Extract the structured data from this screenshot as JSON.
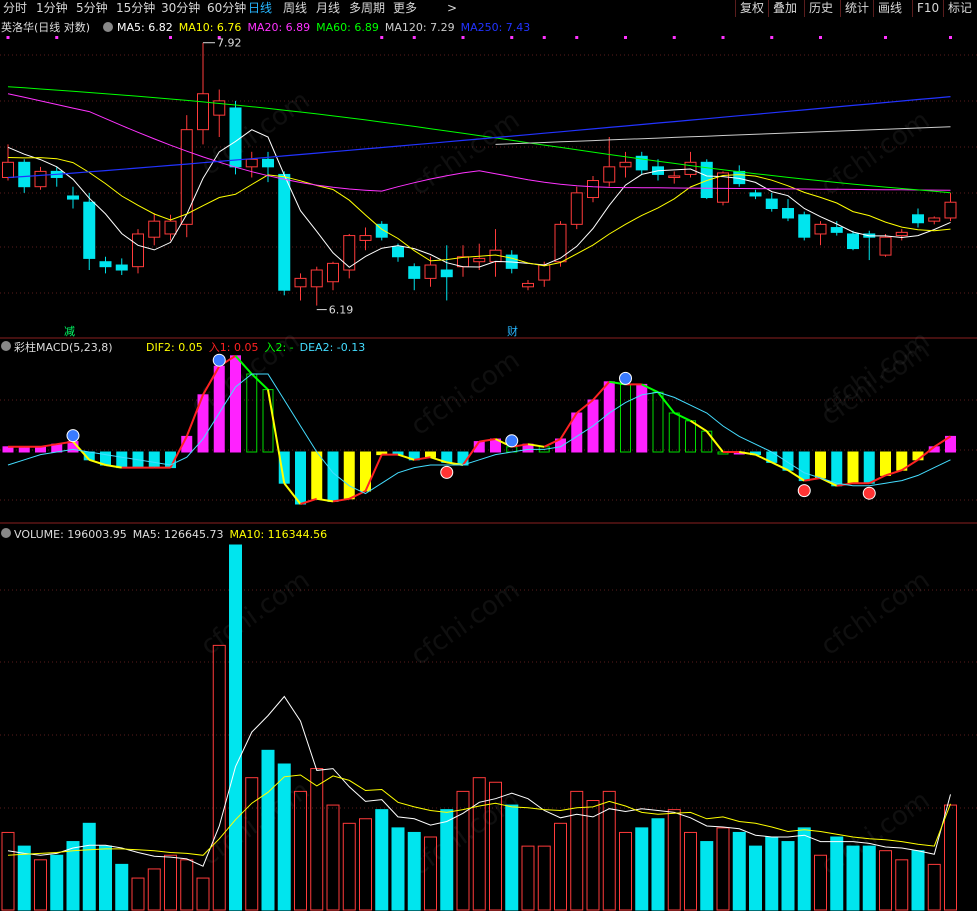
{
  "toolbar": {
    "periods": [
      {
        "label": "分时",
        "active": false
      },
      {
        "label": "1分钟",
        "active": false
      },
      {
        "label": "5分钟",
        "active": false
      },
      {
        "label": "15分钟",
        "active": false
      },
      {
        "label": "30分钟",
        "active": false
      },
      {
        "label": "60分钟",
        "active": false
      },
      {
        "label": "日线",
        "active": true
      },
      {
        "label": "周线",
        "active": false
      },
      {
        "label": "月线",
        "active": false
      },
      {
        "label": "多周期",
        "active": false
      },
      {
        "label": "更多",
        "active": false
      }
    ],
    "more_arrow": ">",
    "actions": [
      "复权",
      "叠加",
      "历史",
      "统计",
      "画线",
      "F10",
      "标记"
    ]
  },
  "price_panel": {
    "title": "英洛华(日线 对数)",
    "ma": [
      {
        "label": "MA5: 6.82",
        "color": "#ffffff"
      },
      {
        "label": "MA10: 6.76",
        "color": "#ffff00"
      },
      {
        "label": "MA20: 6.89",
        "color": "#ff33ff"
      },
      {
        "label": "MA60: 6.89",
        "color": "#00ff00"
      },
      {
        "label": "MA120: 7.29",
        "color": "#cccccc"
      },
      {
        "label": "MA250: 7.43",
        "color": "#2233ff"
      }
    ],
    "high_label": "7.92",
    "low_label": "6.19",
    "marker_jian": "减",
    "marker_cai": "财"
  },
  "macd_panel": {
    "title": "彩柱MACD(5,23,8)",
    "values": [
      {
        "label": "DIF2: 0.05",
        "color": "#ffff00"
      },
      {
        "label": "入1: 0.05",
        "color": "#ff2222"
      },
      {
        "label": "入2: -",
        "color": "#00ff00"
      },
      {
        "label": "DEA2: -0.13",
        "color": "#44ddff"
      }
    ]
  },
  "volume_panel": {
    "values": [
      {
        "label": "VOLUME: 196003.95",
        "color": "#dddddd"
      },
      {
        "label": "MA5: 126645.73",
        "color": "#dddddd"
      },
      {
        "label": "MA10: 116344.56",
        "color": "#ffff00"
      }
    ]
  },
  "watermark": "cfchi.com",
  "colors": {
    "up": "#ff3b3b",
    "down": "#00e5ee",
    "background": "#000000",
    "grid": "#5a1d1d"
  },
  "chart_data": [
    {
      "type": "candlestick",
      "title": "英洛华(日线 对数)",
      "yscale": "log",
      "ylim": [
        6.05,
        8.0
      ],
      "annotations": [
        {
          "text": "7.92",
          "x": 13
        },
        {
          "text": "6.19",
          "x": 20
        }
      ],
      "candles": [
        [
          6.98,
          7.2,
          6.96,
          7.08
        ],
        [
          7.08,
          7.1,
          6.88,
          6.92
        ],
        [
          6.92,
          7.05,
          6.9,
          7.02
        ],
        [
          7.02,
          7.05,
          6.92,
          6.98
        ],
        [
          6.86,
          6.92,
          6.78,
          6.84
        ],
        [
          6.82,
          6.88,
          6.4,
          6.47
        ],
        [
          6.45,
          6.48,
          6.38,
          6.42
        ],
        [
          6.43,
          6.47,
          6.37,
          6.4
        ],
        [
          6.42,
          6.65,
          6.38,
          6.62
        ],
        [
          6.6,
          6.75,
          6.55,
          6.7
        ],
        [
          6.62,
          6.74,
          6.58,
          6.7
        ],
        [
          6.68,
          7.4,
          6.6,
          7.3
        ],
        [
          7.3,
          7.92,
          7.2,
          7.55
        ],
        [
          7.4,
          7.58,
          7.25,
          7.5
        ],
        [
          7.45,
          7.5,
          7.0,
          7.05
        ],
        [
          7.05,
          7.15,
          6.98,
          7.1
        ],
        [
          7.1,
          7.15,
          6.95,
          7.05
        ],
        [
          7.0,
          7.02,
          6.25,
          6.28
        ],
        [
          6.3,
          6.38,
          6.22,
          6.35
        ],
        [
          6.3,
          6.42,
          6.19,
          6.4
        ],
        [
          6.33,
          6.45,
          6.28,
          6.44
        ],
        [
          6.4,
          6.62,
          6.35,
          6.61
        ],
        [
          6.58,
          6.66,
          6.52,
          6.61
        ],
        [
          6.68,
          6.7,
          6.58,
          6.6
        ],
        [
          6.54,
          6.56,
          6.45,
          6.48
        ],
        [
          6.42,
          6.44,
          6.28,
          6.35
        ],
        [
          6.35,
          6.48,
          6.3,
          6.43
        ],
        [
          6.4,
          6.55,
          6.22,
          6.36
        ],
        [
          6.42,
          6.55,
          6.36,
          6.48
        ],
        [
          6.45,
          6.56,
          6.4,
          6.47
        ],
        [
          6.45,
          6.65,
          6.36,
          6.52
        ],
        [
          6.49,
          6.52,
          6.38,
          6.41
        ],
        [
          6.3,
          6.34,
          6.28,
          6.32
        ],
        [
          6.34,
          6.45,
          6.3,
          6.43
        ],
        [
          6.45,
          6.7,
          6.42,
          6.68
        ],
        [
          6.68,
          6.92,
          6.65,
          6.88
        ],
        [
          6.85,
          6.99,
          6.82,
          6.96
        ],
        [
          6.95,
          7.25,
          6.92,
          7.05
        ],
        [
          7.05,
          7.15,
          6.98,
          7.08
        ],
        [
          7.12,
          7.15,
          7.0,
          7.03
        ],
        [
          7.05,
          7.1,
          6.96,
          7.0
        ],
        [
          6.98,
          7.02,
          6.94,
          6.99
        ],
        [
          7.0,
          7.15,
          6.98,
          7.08
        ],
        [
          7.08,
          7.1,
          6.84,
          6.85
        ],
        [
          6.82,
          7.02,
          6.8,
          7.01
        ],
        [
          7.02,
          7.06,
          6.92,
          6.94
        ],
        [
          6.88,
          6.9,
          6.84,
          6.86
        ],
        [
          6.84,
          6.88,
          6.76,
          6.78
        ],
        [
          6.78,
          6.84,
          6.7,
          6.72
        ],
        [
          6.74,
          6.76,
          6.58,
          6.6
        ],
        [
          6.62,
          6.7,
          6.55,
          6.68
        ],
        [
          6.66,
          6.7,
          6.61,
          6.63
        ],
        [
          6.62,
          6.64,
          6.52,
          6.53
        ],
        [
          6.62,
          6.64,
          6.46,
          6.6
        ],
        [
          6.49,
          6.62,
          6.48,
          6.6
        ],
        [
          6.61,
          6.65,
          6.58,
          6.63
        ],
        [
          6.74,
          6.78,
          6.66,
          6.69
        ],
        [
          6.7,
          6.73,
          6.68,
          6.72
        ],
        [
          6.72,
          6.88,
          6.7,
          6.82
        ]
      ]
    },
    {
      "type": "bar",
      "title": "彩柱MACD(5,23,8)",
      "ylim": [
        -0.5,
        0.45
      ],
      "values": [
        0.02,
        0.02,
        0.02,
        0.03,
        0.04,
        -0.03,
        -0.05,
        -0.06,
        -0.06,
        -0.06,
        -0.06,
        0.06,
        0.22,
        0.33,
        0.37,
        0.3,
        0.24,
        -0.12,
        -0.2,
        -0.18,
        -0.19,
        -0.18,
        -0.15,
        -0.01,
        -0.01,
        -0.03,
        -0.02,
        -0.04,
        -0.05,
        0.04,
        0.05,
        0.02,
        0.03,
        0.02,
        0.05,
        0.15,
        0.2,
        0.27,
        0.26,
        0.26,
        0.23,
        0.15,
        0.12,
        0.08,
        0.0,
        0.0,
        -0.01,
        -0.04,
        -0.07,
        -0.11,
        -0.1,
        -0.13,
        -0.12,
        -0.12,
        -0.09,
        -0.07,
        -0.03,
        0.02,
        0.06
      ],
      "series": [
        {
          "name": "DIF2",
          "values": [
            0.02,
            0.02,
            0.02,
            0.03,
            0.04,
            -0.03,
            -0.05,
            -0.06,
            -0.06,
            -0.06,
            -0.06,
            0.06,
            0.22,
            0.33,
            0.37,
            0.3,
            0.24,
            -0.12,
            -0.2,
            -0.18,
            -0.19,
            -0.18,
            -0.15,
            -0.01,
            -0.01,
            -0.03,
            -0.02,
            -0.04,
            -0.05,
            0.04,
            0.05,
            0.02,
            0.03,
            0.02,
            0.05,
            0.15,
            0.2,
            0.27,
            0.26,
            0.26,
            0.23,
            0.15,
            0.12,
            0.08,
            0.0,
            0.0,
            -0.01,
            -0.04,
            -0.07,
            -0.11,
            -0.1,
            -0.13,
            -0.12,
            -0.12,
            -0.09,
            -0.07,
            -0.03,
            0.02,
            0.06
          ]
        },
        {
          "name": "DEA2",
          "values": [
            -0.05,
            -0.03,
            -0.01,
            0.0,
            0.01,
            0.0,
            -0.01,
            -0.02,
            -0.03,
            -0.04,
            -0.05,
            -0.02,
            0.05,
            0.15,
            0.25,
            0.3,
            0.3,
            0.2,
            0.1,
            0.0,
            -0.08,
            -0.13,
            -0.16,
            -0.12,
            -0.08,
            -0.06,
            -0.05,
            -0.05,
            -0.05,
            -0.03,
            -0.01,
            0.0,
            0.01,
            0.01,
            0.02,
            0.06,
            0.1,
            0.15,
            0.19,
            0.22,
            0.23,
            0.21,
            0.18,
            0.15,
            0.1,
            0.06,
            0.03,
            0.0,
            -0.04,
            -0.08,
            -0.1,
            -0.12,
            -0.13,
            -0.13,
            -0.12,
            -0.11,
            -0.09,
            -0.06,
            -0.03
          ]
        }
      ]
    },
    {
      "type": "bar",
      "title": "VOLUME",
      "ylim": [
        0,
        400000
      ],
      "values": [
        85000,
        70000,
        55000,
        60000,
        75000,
        95000,
        70000,
        50000,
        35000,
        45000,
        60000,
        55000,
        35000,
        290000,
        400000,
        145000,
        175000,
        160000,
        130000,
        155000,
        115000,
        95000,
        100000,
        110000,
        90000,
        85000,
        80000,
        110000,
        130000,
        145000,
        140000,
        115000,
        70000,
        70000,
        95000,
        130000,
        120000,
        130000,
        85000,
        90000,
        100000,
        110000,
        85000,
        75000,
        90000,
        85000,
        70000,
        80000,
        75000,
        90000,
        60000,
        80000,
        70000,
        70000,
        65000,
        55000,
        65000,
        50000,
        115000
      ],
      "series": [
        {
          "name": "MA5",
          "values": [
            65000,
            62000,
            60000,
            62000,
            68000,
            71000,
            71000,
            68000,
            63000,
            59000,
            58000,
            56000,
            48000,
            92000,
            157000,
            195000,
            213000,
            234000,
            207000,
            153000,
            155000,
            135000,
            119000,
            121000,
            102000,
            100000,
            93000,
            97000,
            106000,
            118000,
            122000,
            128000,
            122000,
            109000,
            101000,
            105000,
            102000,
            111000,
            108000,
            111000,
            109000,
            107000,
            101000,
            92000,
            91000,
            89000,
            82000,
            80000,
            80000,
            82000,
            75000,
            75000,
            75000,
            73000,
            69000,
            68000,
            65000,
            61000,
            126645.73
          ]
        },
        {
          "name": "MA10",
          "values": [
            60000,
            61000,
            62000,
            63000,
            65000,
            66000,
            67000,
            67000,
            66000,
            65000,
            63000,
            62000,
            60000,
            78000,
            99000,
            117000,
            129000,
            146000,
            148000,
            136000,
            147000,
            142000,
            131000,
            132000,
            118000,
            113000,
            109000,
            107000,
            110000,
            114000,
            117000,
            113000,
            112000,
            110000,
            109000,
            112000,
            113000,
            119000,
            114000,
            107000,
            105000,
            106000,
            107000,
            100000,
            102000,
            97000,
            95000,
            91000,
            86000,
            88000,
            86000,
            83000,
            80000,
            78000,
            77000,
            75000,
            72000,
            70000,
            116344.56
          ]
        }
      ]
    }
  ]
}
